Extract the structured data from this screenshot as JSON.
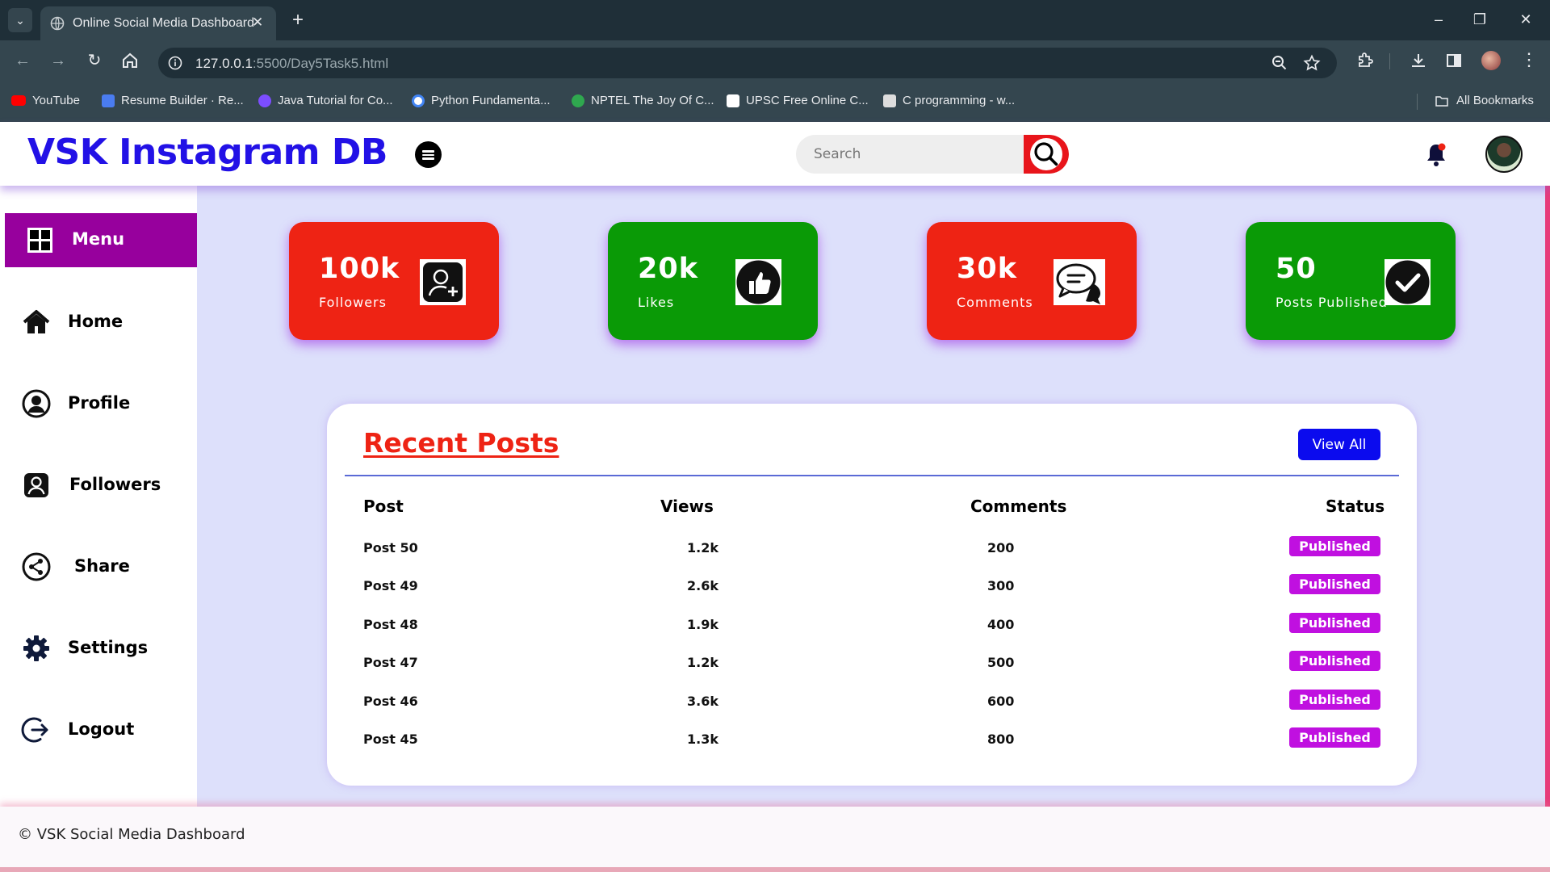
{
  "browser": {
    "tab_title": "Online Social Media Dashboard",
    "url_host": "127.0.0.1",
    "url_rest": ":5500/Day5Task5.html",
    "bookmarks": [
      {
        "label": "YouTube",
        "color": "#ff0000"
      },
      {
        "label": "Resume Builder · Re...",
        "color": "#4a7cf0"
      },
      {
        "label": "Java Tutorial for Co...",
        "color": "#7c4dff"
      },
      {
        "label": "Python Fundamenta...",
        "color": "#ffffff"
      },
      {
        "label": "NPTEL The Joy Of C...",
        "color": "#2fa84f"
      },
      {
        "label": "UPSC Free Online C...",
        "color": "#ffffff"
      },
      {
        "label": "C programming - w...",
        "color": "#dddddd"
      }
    ],
    "all_bookmarks": "All Bookmarks"
  },
  "header": {
    "brand": "VSK Instagram DB",
    "search_placeholder": "Search"
  },
  "sidebar": {
    "menu_label": "Menu",
    "items": [
      {
        "label": "Home",
        "icon": "home-icon"
      },
      {
        "label": "Profile",
        "icon": "user-circle-icon"
      },
      {
        "label": "Followers",
        "icon": "user-square-icon"
      },
      {
        "label": "Share",
        "icon": "share-icon"
      },
      {
        "label": "Settings",
        "icon": "gear-icon"
      },
      {
        "label": "Logout",
        "icon": "logout-icon"
      }
    ]
  },
  "stats": [
    {
      "value": "100k",
      "label": "Followers",
      "icon": "add-user-icon",
      "color": "#ee2314"
    },
    {
      "value": "20k",
      "label": "Likes",
      "icon": "thumbs-up-icon",
      "color": "#0a9a06"
    },
    {
      "value": "30k",
      "label": "Comments",
      "icon": "chat-bubbles-icon",
      "color": "#ee2314"
    },
    {
      "value": "50",
      "label": "Posts Published",
      "icon": "check-circle-icon",
      "color": "#0a9a06"
    }
  ],
  "recent_posts": {
    "title": "Recent Posts",
    "view_all": "View All",
    "headers": [
      "Post",
      "Views",
      "Comments",
      "Status"
    ],
    "rows": [
      {
        "post": "Post 50",
        "views": "1.2k",
        "comments": "200",
        "status": "Published"
      },
      {
        "post": "Post 49",
        "views": "2.6k",
        "comments": "300",
        "status": "Published"
      },
      {
        "post": "Post 48",
        "views": "1.9k",
        "comments": "400",
        "status": "Published"
      },
      {
        "post": "Post 47",
        "views": "1.2k",
        "comments": "500",
        "status": "Published"
      },
      {
        "post": "Post 46",
        "views": "3.6k",
        "comments": "600",
        "status": "Published"
      },
      {
        "post": "Post 45",
        "views": "1.3k",
        "comments": "800",
        "status": "Published"
      }
    ]
  },
  "footer": {
    "text": "© VSK Social Media Dashboard"
  },
  "colors": {
    "brand": "#2211e6",
    "accent_red": "#ee2314",
    "accent_green": "#0a9a06",
    "menu_purple": "#97009d",
    "badge_purple": "#c010e0",
    "view_all_blue": "#0b0bee"
  }
}
